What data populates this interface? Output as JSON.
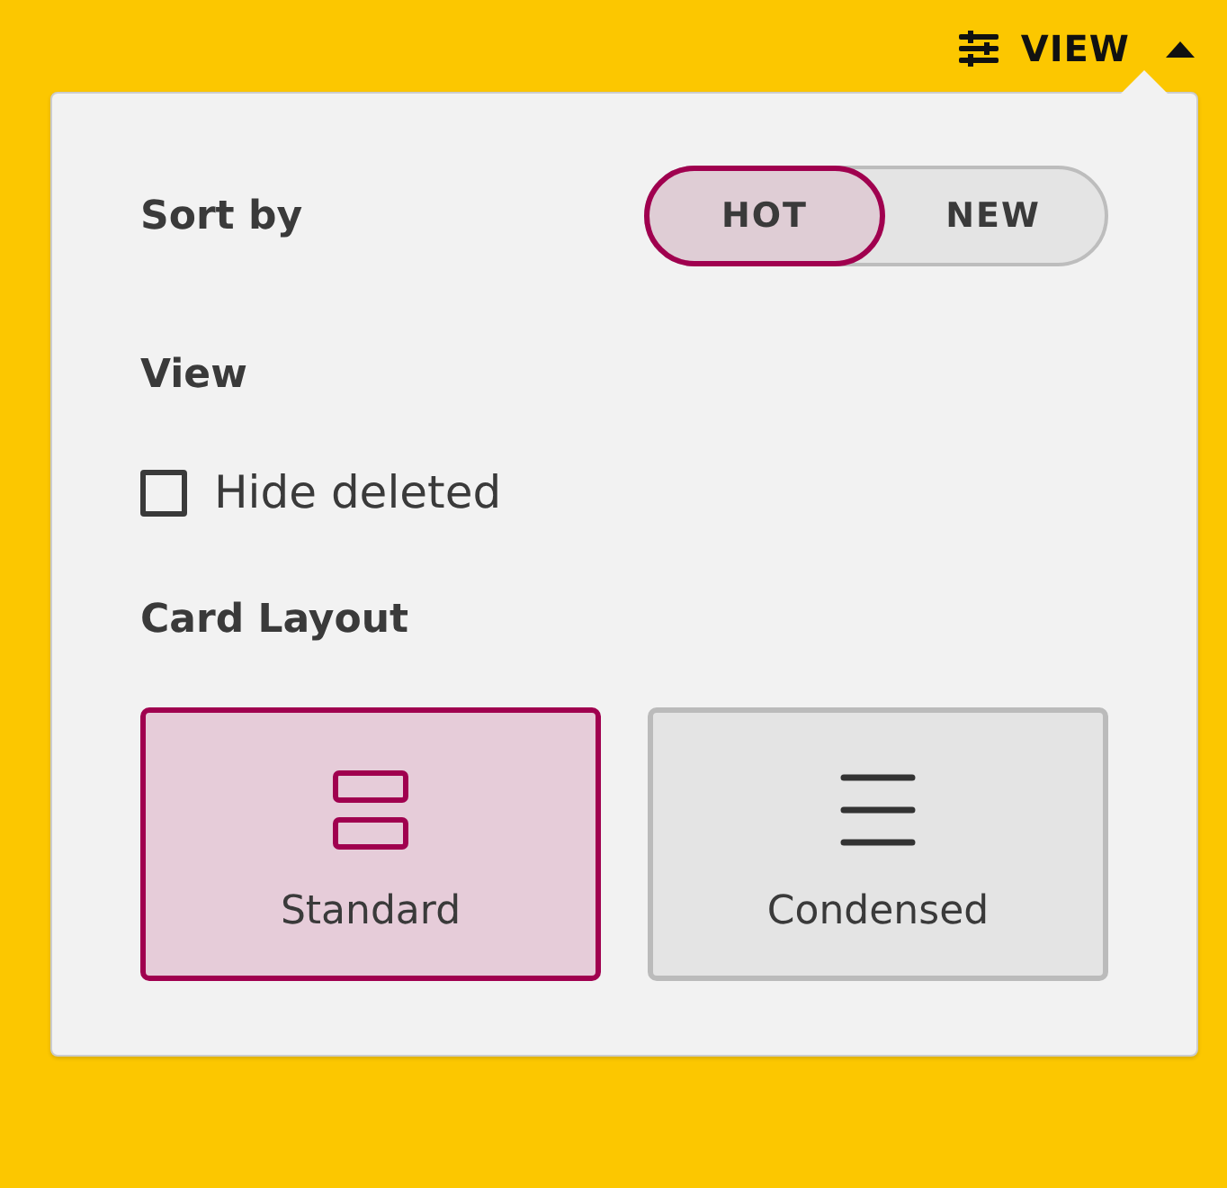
{
  "view_button": {
    "label": "VIEW",
    "expanded": true
  },
  "sort": {
    "label": "Sort by",
    "options": [
      {
        "label": "HOT",
        "selected": true
      },
      {
        "label": "NEW",
        "selected": false
      }
    ]
  },
  "view": {
    "heading": "View",
    "hide_deleted": {
      "label": "Hide deleted",
      "checked": false
    }
  },
  "card_layout": {
    "heading": "Card Layout",
    "options": [
      {
        "kind": "standard",
        "label": "Standard",
        "selected": true
      },
      {
        "kind": "condensed",
        "label": "Condensed",
        "selected": false
      }
    ]
  }
}
